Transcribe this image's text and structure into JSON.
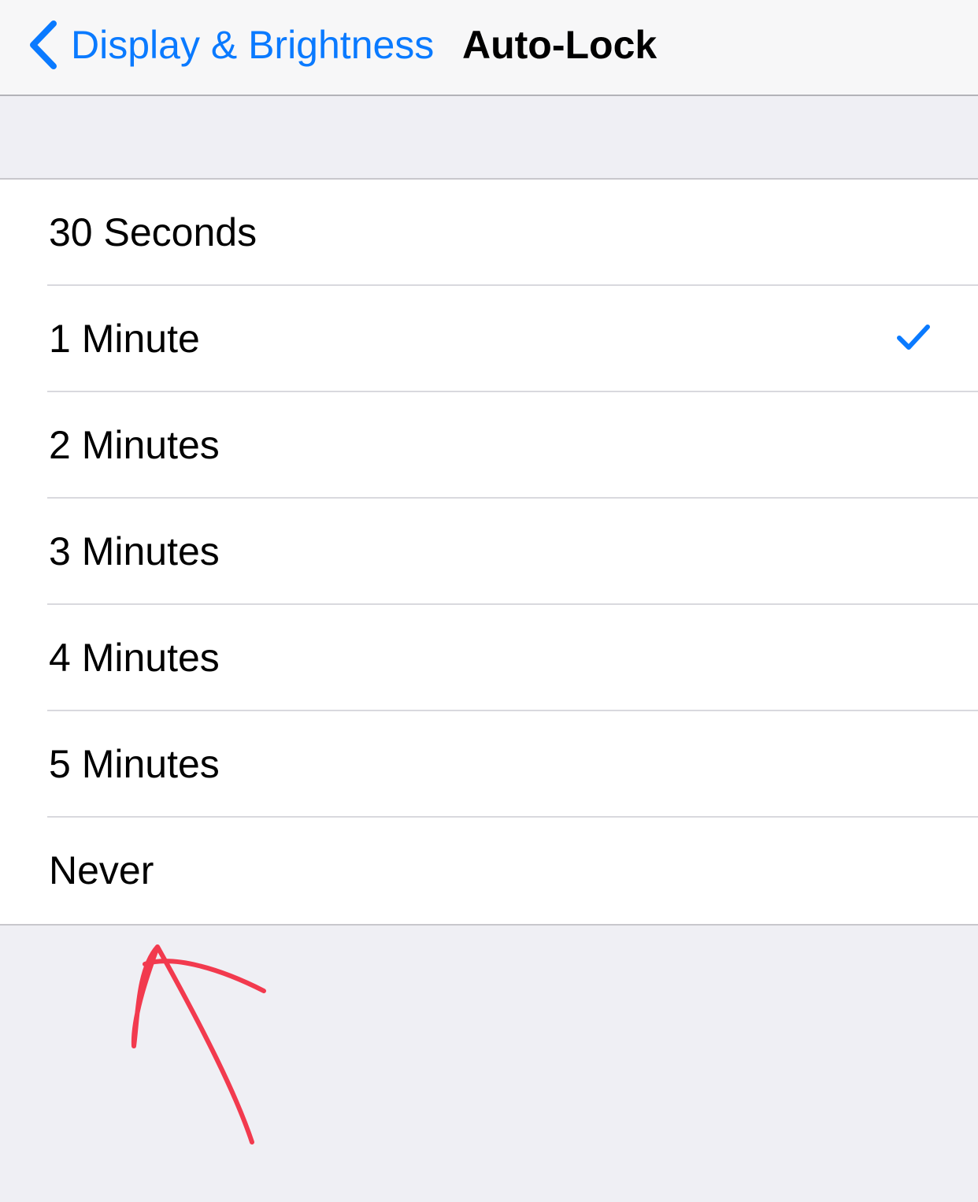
{
  "navbar": {
    "back_label": "Display & Brightness",
    "title": "Auto-Lock"
  },
  "options": [
    {
      "label": "30 Seconds",
      "selected": false
    },
    {
      "label": "1 Minute",
      "selected": true
    },
    {
      "label": "2 Minutes",
      "selected": false
    },
    {
      "label": "3 Minutes",
      "selected": false
    },
    {
      "label": "4 Minutes",
      "selected": false
    },
    {
      "label": "5 Minutes",
      "selected": false
    },
    {
      "label": "Never",
      "selected": false
    }
  ],
  "colors": {
    "accent": "#0a7aff",
    "background": "#efeff4",
    "annotation": "#f23a4e"
  },
  "icons": {
    "back": "chevron-left-icon",
    "selected": "checkmark-icon",
    "annotation": "arrow-annotation-icon"
  }
}
